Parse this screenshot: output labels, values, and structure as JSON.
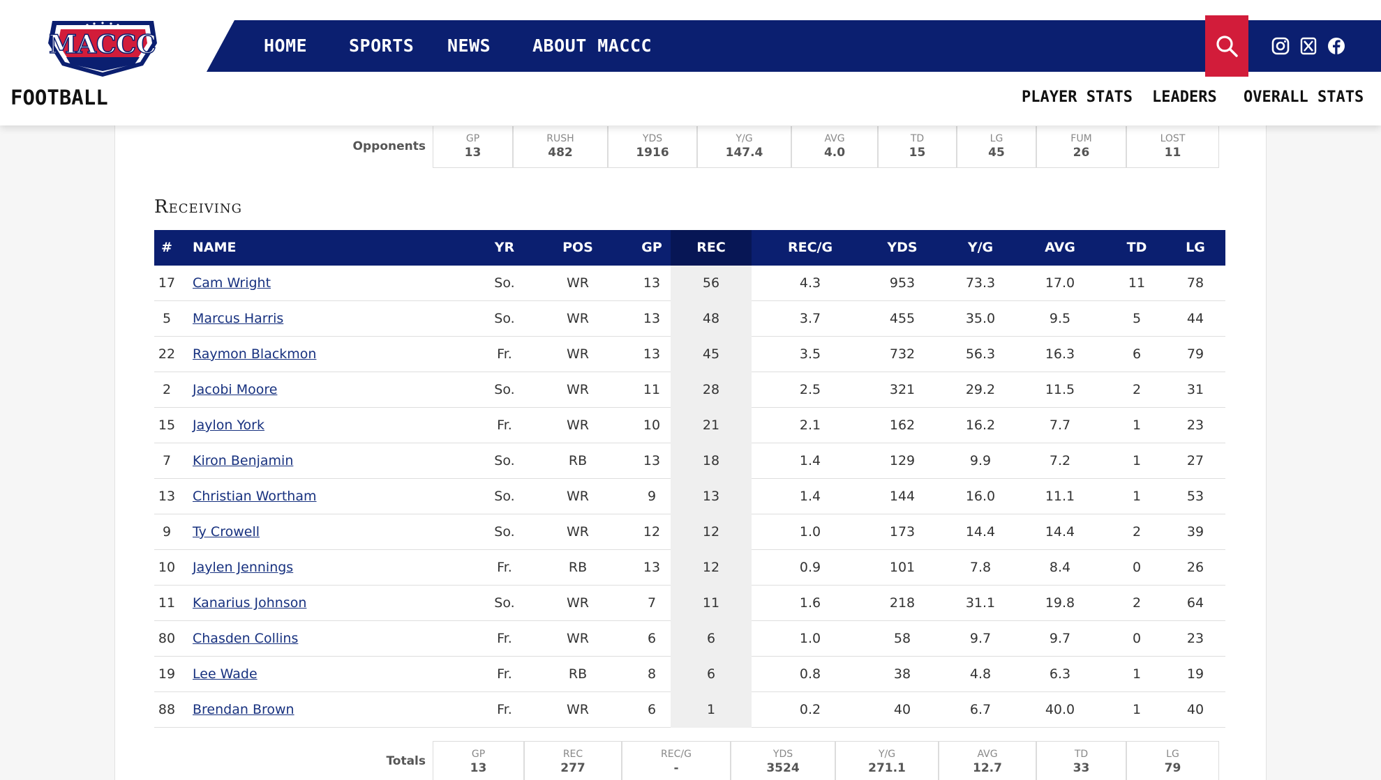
{
  "header": {
    "logo_text": "MACCC",
    "nav": [
      "HOME",
      "SPORTS",
      "NEWS",
      "ABOUT MACCC"
    ],
    "sport_title": "FOOTBALL",
    "subnav": [
      "PLAYER STATS",
      "LEADERS",
      "OVERALL STATS"
    ]
  },
  "colors": {
    "navy": "#0b1f70",
    "red": "#d21c3a"
  },
  "opponents_summary": {
    "label": "Opponents",
    "cells": [
      {
        "h": "GP",
        "v": "13"
      },
      {
        "h": "RUSH",
        "v": "482"
      },
      {
        "h": "YDS",
        "v": "1916"
      },
      {
        "h": "Y/G",
        "v": "147.4"
      },
      {
        "h": "AVG",
        "v": "4.0"
      },
      {
        "h": "TD",
        "v": "15"
      },
      {
        "h": "LG",
        "v": "45"
      },
      {
        "h": "FUM",
        "v": "26"
      },
      {
        "h": "LOST",
        "v": "11"
      }
    ]
  },
  "receiving": {
    "title": "Receiving",
    "columns": [
      "#",
      "NAME",
      "YR",
      "POS",
      "GP",
      "REC",
      "REC/G",
      "YDS",
      "Y/G",
      "AVG",
      "TD",
      "LG"
    ],
    "rows": [
      [
        "17",
        "Cam Wright",
        "So.",
        "WR",
        "13",
        "56",
        "4.3",
        "953",
        "73.3",
        "17.0",
        "11",
        "78"
      ],
      [
        "5",
        "Marcus Harris",
        "So.",
        "WR",
        "13",
        "48",
        "3.7",
        "455",
        "35.0",
        "9.5",
        "5",
        "44"
      ],
      [
        "22",
        "Raymon Blackmon",
        "Fr.",
        "WR",
        "13",
        "45",
        "3.5",
        "732",
        "56.3",
        "16.3",
        "6",
        "79"
      ],
      [
        "2",
        "Jacobi Moore",
        "So.",
        "WR",
        "11",
        "28",
        "2.5",
        "321",
        "29.2",
        "11.5",
        "2",
        "31"
      ],
      [
        "15",
        "Jaylon York",
        "Fr.",
        "WR",
        "10",
        "21",
        "2.1",
        "162",
        "16.2",
        "7.7",
        "1",
        "23"
      ],
      [
        "7",
        "Kiron Benjamin",
        "So.",
        "RB",
        "13",
        "18",
        "1.4",
        "129",
        "9.9",
        "7.2",
        "1",
        "27"
      ],
      [
        "13",
        "Christian Wortham",
        "So.",
        "WR",
        "9",
        "13",
        "1.4",
        "144",
        "16.0",
        "11.1",
        "1",
        "53"
      ],
      [
        "9",
        "Ty Crowell",
        "So.",
        "WR",
        "12",
        "12",
        "1.0",
        "173",
        "14.4",
        "14.4",
        "2",
        "39"
      ],
      [
        "10",
        "Jaylen Jennings",
        "Fr.",
        "RB",
        "13",
        "12",
        "0.9",
        "101",
        "7.8",
        "8.4",
        "0",
        "26"
      ],
      [
        "11",
        "Kanarius Johnson",
        "So.",
        "WR",
        "7",
        "11",
        "1.6",
        "218",
        "31.1",
        "19.8",
        "2",
        "64"
      ],
      [
        "80",
        "Chasden Collins",
        "Fr.",
        "WR",
        "6",
        "6",
        "1.0",
        "58",
        "9.7",
        "9.7",
        "0",
        "23"
      ],
      [
        "19",
        "Lee Wade",
        "Fr.",
        "RB",
        "8",
        "6",
        "0.8",
        "38",
        "4.8",
        "6.3",
        "1",
        "19"
      ],
      [
        "88",
        "Brendan Brown",
        "Fr.",
        "WR",
        "6",
        "1",
        "0.2",
        "40",
        "6.7",
        "40.0",
        "1",
        "40"
      ]
    ]
  },
  "totals_summary": {
    "label": "Totals",
    "cells": [
      {
        "h": "GP",
        "v": "13"
      },
      {
        "h": "REC",
        "v": "277"
      },
      {
        "h": "REC/G",
        "v": "-"
      },
      {
        "h": "YDS",
        "v": "3524"
      },
      {
        "h": "Y/G",
        "v": "271.1"
      },
      {
        "h": "AVG",
        "v": "12.7"
      },
      {
        "h": "TD",
        "v": "33"
      },
      {
        "h": "LG",
        "v": "79"
      }
    ]
  }
}
